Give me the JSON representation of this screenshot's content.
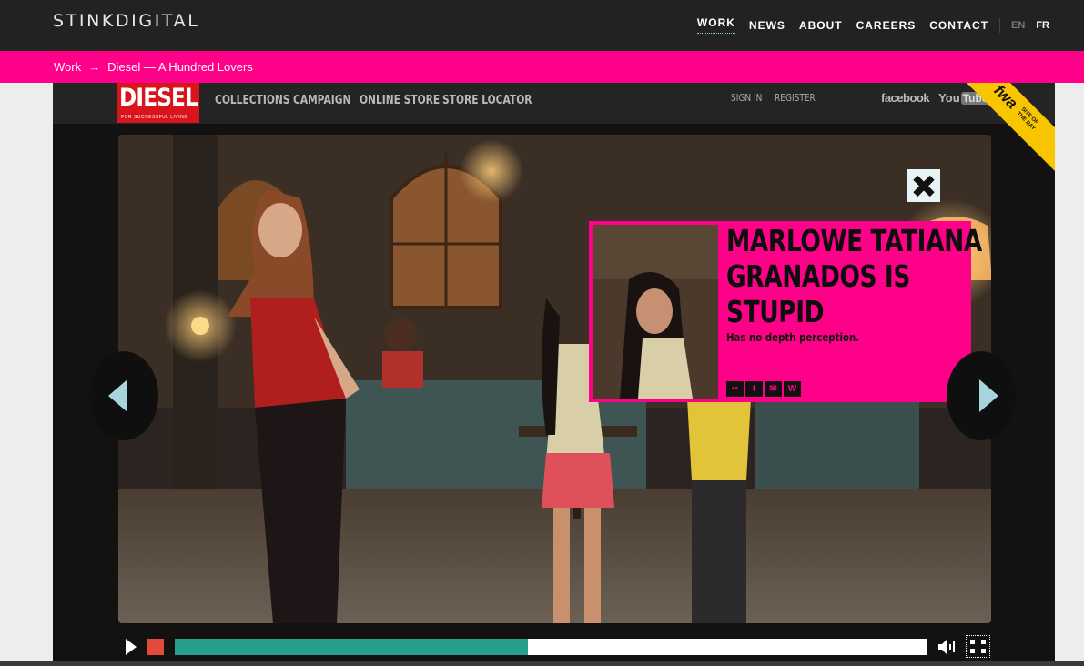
{
  "header": {
    "logo": "STINKDIGITAL",
    "nav": [
      {
        "label": "WORK",
        "active": true
      },
      {
        "label": "NEWS",
        "active": false
      },
      {
        "label": "ABOUT",
        "active": false
      },
      {
        "label": "CAREERS",
        "active": false
      },
      {
        "label": "CONTACT",
        "active": false
      }
    ],
    "languages": [
      {
        "label": "EN",
        "selected": false
      },
      {
        "label": "FR",
        "selected": true
      }
    ]
  },
  "breadcrumb": {
    "root": "Work",
    "separator": "→",
    "current": "Diesel — A Hundred Lovers"
  },
  "diesel_site": {
    "logo_text": "DIESEL",
    "logo_tagline": "FOR SUCCESSFUL LIVING",
    "nav": [
      "COLLECTIONS",
      "CAMPAIGN",
      "ONLINE STORE",
      "STORE LOCATOR"
    ],
    "account": [
      "SIGN IN",
      "REGISTER"
    ],
    "social": {
      "facebook": "facebook",
      "youtube_you": "You",
      "youtube_tube": "Tube"
    },
    "badge": {
      "logo": "fwa",
      "line1": "SITE OF",
      "line2": "THE DAY"
    }
  },
  "popup": {
    "headline_lines": [
      "MARLOWE TATIANA",
      "GRANADOS IS",
      "STUPID"
    ],
    "subtext": "Has no depth perception.",
    "share_icons": [
      "flickr-icon",
      "twitter-icon",
      "myspace-icon",
      "wordpress-icon"
    ],
    "share_glyphs": [
      "••",
      "t",
      "✉",
      "W"
    ]
  },
  "player": {
    "progress_fraction": 0.47
  },
  "colors": {
    "pink": "#ff0088",
    "teal": "#24a08c",
    "diesel_red": "#d9141b",
    "fwa_yellow": "#f7c600"
  }
}
